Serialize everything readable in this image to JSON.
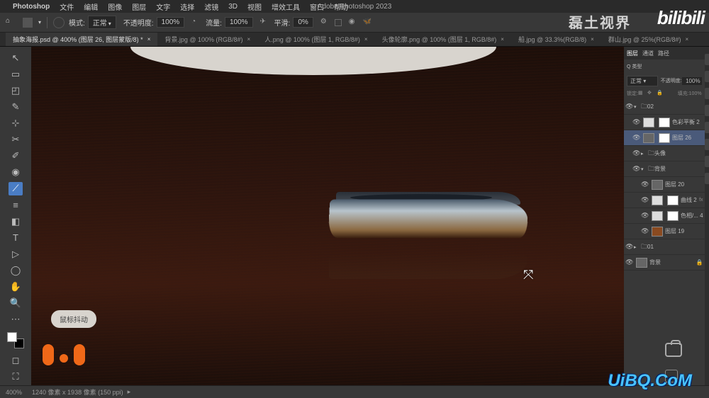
{
  "app": {
    "name": "Photoshop",
    "title": "Adobe Photoshop 2023"
  },
  "menus": [
    "文件",
    "编辑",
    "图像",
    "图层",
    "文字",
    "选择",
    "滤镜",
    "3D",
    "视图",
    "增效工具",
    "窗口",
    "帮助"
  ],
  "options": {
    "mode_label": "模式:",
    "mode_value": "正常",
    "opacity_label": "不透明度:",
    "opacity_value": "100%",
    "flow_label": "流量:",
    "flow_value": "100%",
    "smooth_label": "平滑:",
    "smooth_value": "0%"
  },
  "tabs": [
    {
      "label": "抽象海报.psd @ 400% (图层 26, 图层蒙版/8) *",
      "active": true
    },
    {
      "label": "背景.jpg @ 100% (RGB/8#)",
      "active": false
    },
    {
      "label": "人.png @ 100% (图层 1, RGB/8#)",
      "active": false
    },
    {
      "label": "头像轮廓.png @ 100% (图层 1, RGB/8#)",
      "active": false
    },
    {
      "label": "船.jpg @ 33.3%(RGB/8)",
      "active": false
    },
    {
      "label": "群山.jpg @ 25%(RGB/8#)",
      "active": false
    }
  ],
  "panel": {
    "tabs": [
      "图层",
      "通道",
      "路径"
    ],
    "search_label": "Q 类型",
    "blend_mode": "正常",
    "opacity_label": "不透明度:",
    "opacity_value": "100%",
    "lock_label": "锁定:",
    "fill_label": "填充:",
    "fill_value": "100%"
  },
  "layers": [
    {
      "type": "group",
      "name": "02",
      "eye": true,
      "open": true,
      "indent": 0
    },
    {
      "type": "adj",
      "name": "色彩平衡 2",
      "eye": true,
      "indent": 1
    },
    {
      "type": "layer",
      "name": "图层 26",
      "eye": true,
      "selected": true,
      "mask": true,
      "indent": 1
    },
    {
      "type": "group",
      "name": "头像",
      "eye": true,
      "open": false,
      "indent": 1
    },
    {
      "type": "group",
      "name": "背景",
      "eye": true,
      "open": true,
      "indent": 1
    },
    {
      "type": "layer",
      "name": "图层 20",
      "eye": true,
      "indent": 2
    },
    {
      "type": "adj",
      "name": "曲线 2",
      "eye": true,
      "mask": true,
      "fx": true,
      "indent": 2
    },
    {
      "type": "adj",
      "name": "色相/... 4",
      "eye": true,
      "mask": true,
      "indent": 2
    },
    {
      "type": "layer",
      "name": "图层 19",
      "eye": true,
      "indent": 2
    },
    {
      "type": "group",
      "name": "01",
      "eye": true,
      "open": false,
      "indent": 0
    },
    {
      "type": "bg",
      "name": "背景",
      "eye": true,
      "lock": true,
      "indent": 0
    }
  ],
  "status": {
    "zoom": "400%",
    "info": "1240 像素 x 1938 像素 (150 ppi)"
  },
  "tooltip": "鼠标抖动",
  "watermarks": {
    "topright": "磊土视界",
    "bili": "bilibili",
    "bottomright": "UiBQ.CoM"
  },
  "tools": [
    "↖",
    "▭",
    "◰",
    "✎",
    "⊹",
    "✂",
    "✐",
    "◉",
    "⟋",
    "≡",
    "◧",
    "T",
    "▷",
    "◯",
    "✋",
    "🔍"
  ]
}
